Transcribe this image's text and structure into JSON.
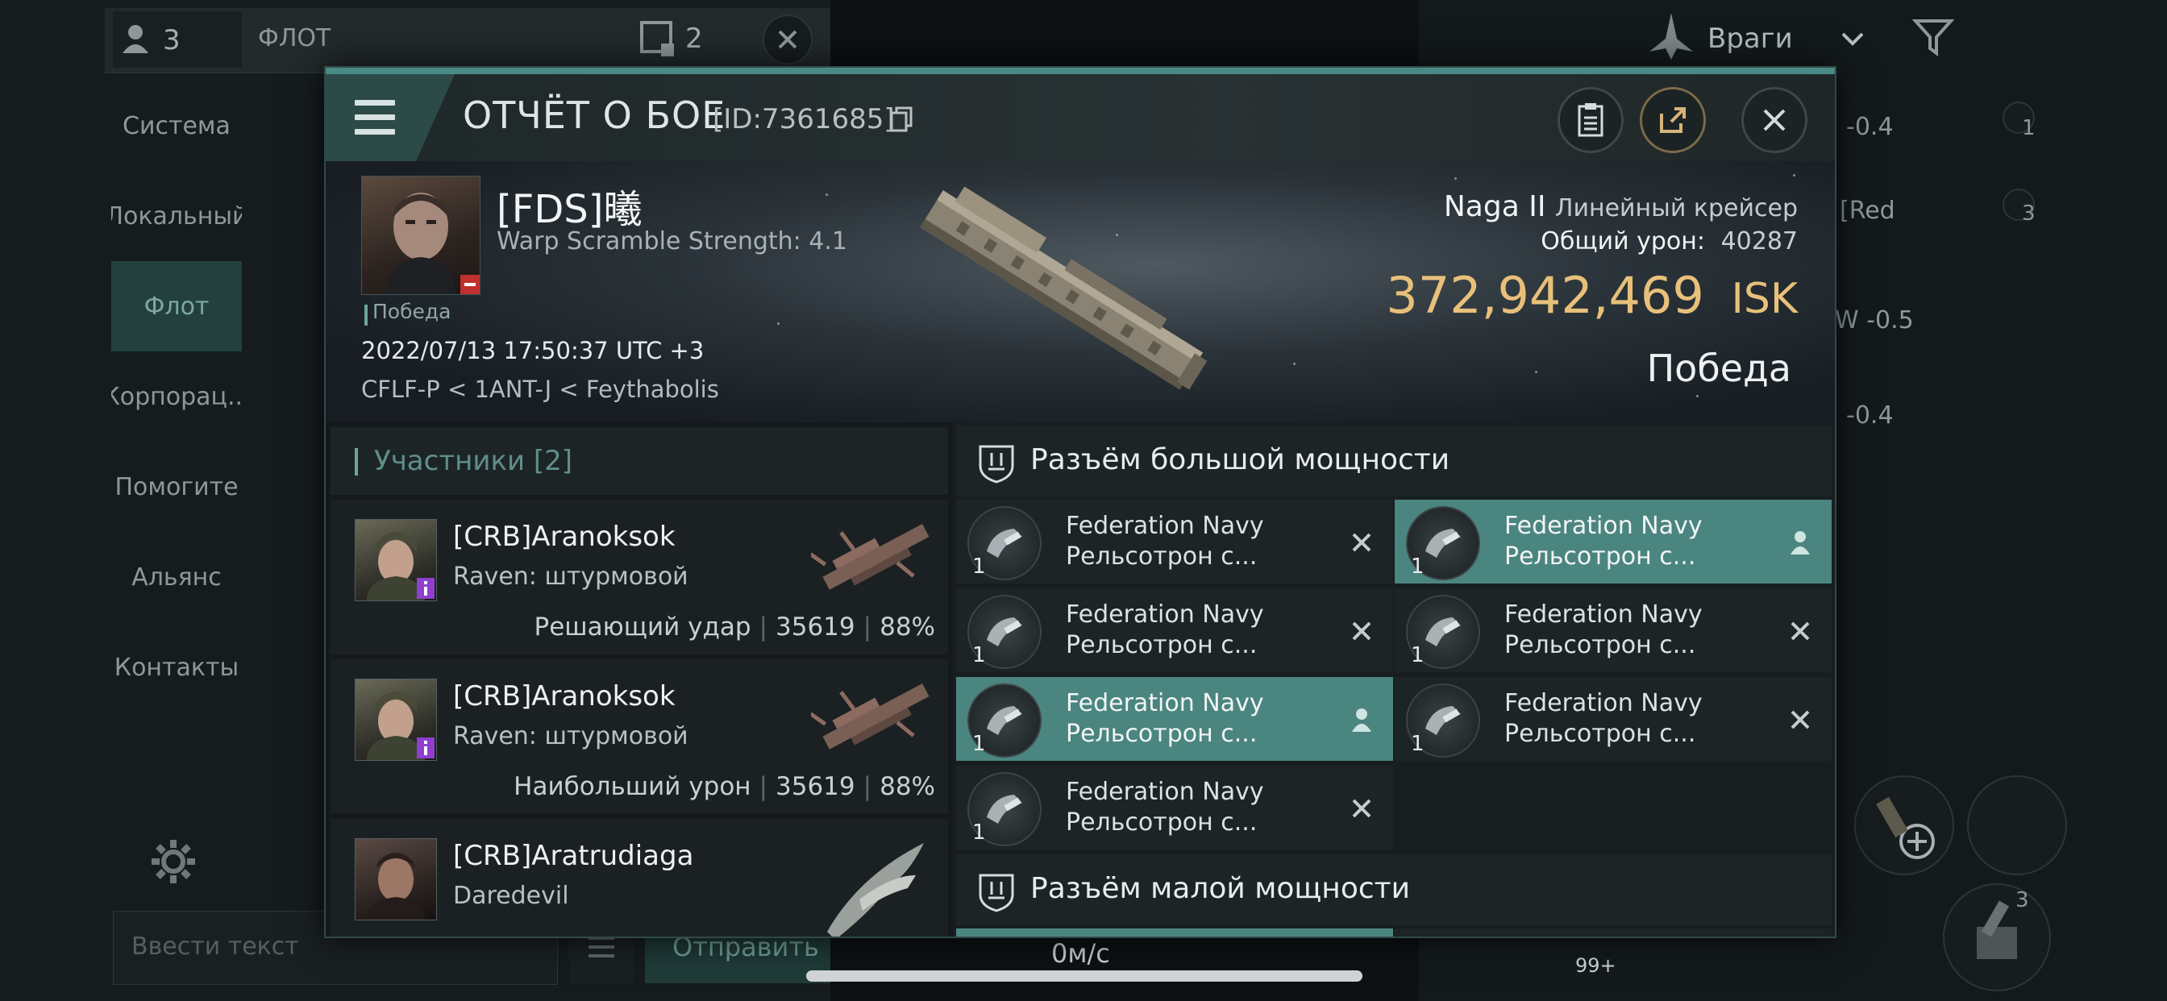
{
  "background": {
    "fleet_count": "3",
    "tab_label": "ФЛОТ",
    "window_count": "2",
    "filter_label": "Враги",
    "channels": [
      "Система",
      "Локальный",
      "Флот",
      "Корпорац...",
      "Помогите",
      "Альянс",
      "Контакты"
    ],
    "active_channel": "Флот",
    "input_placeholder": "Ввести текст",
    "send_label": "Отправить",
    "right_values": [
      "-0.4",
      "[Red",
      "W -0.5",
      "-0.4"
    ],
    "right_counts": [
      "1",
      "3"
    ],
    "speed": "0м/с",
    "module_count": "3",
    "ammo_count": "99+"
  },
  "report": {
    "title": "ОТЧЁТ О БОЕ",
    "id": "[ID:7361685]",
    "victim": {
      "name": "[FDS]曦",
      "sub": "Warp Scramble Strength: 4.1",
      "result": "Победа",
      "date": "2022/07/13 17:50:37 UTC +3",
      "location": "CFLF-P < 1ANT-J < Feythabolis",
      "ship": "Naga II",
      "ship_class": "Линейный крейсер",
      "damage_label": "Общий урон:",
      "damage_value": "40287",
      "isk_value": "372,942,469",
      "isk_unit": "ISK",
      "outcome": "Победа"
    },
    "participants": {
      "title": "Участники [2]",
      "rows": [
        {
          "name": "[CRB]Aranoksok",
          "ship": "Raven: штурмовой",
          "role": "Решающий удар",
          "damage": "35619",
          "percent": "88%"
        },
        {
          "name": "[CRB]Aranoksok",
          "ship": "Raven: штурмовой",
          "role": "Наибольший урон",
          "damage": "35619",
          "percent": "88%"
        },
        {
          "name": "[CRB]Aratrudiaga",
          "ship": "Daredevil",
          "role": "",
          "damage": "",
          "percent": ""
        }
      ]
    },
    "high_slots": {
      "title": "Разъём большой мощности",
      "modules": [
        {
          "line1": "Federation Navy",
          "line2": "Рельсотрон с...",
          "qty": "1",
          "state": "destroyed",
          "action_icon": "x-icon"
        },
        {
          "line1": "Federation Navy",
          "line2": "Рельсотрон с...",
          "qty": "1",
          "state": "dropped",
          "action_icon": "person-icon"
        },
        {
          "line1": "Federation Navy",
          "line2": "Рельсотрон с...",
          "qty": "1",
          "state": "destroyed",
          "action_icon": "x-icon"
        },
        {
          "line1": "Federation Navy",
          "line2": "Рельсотрон с...",
          "qty": "1",
          "state": "destroyed",
          "action_icon": "x-icon"
        },
        {
          "line1": "Federation Navy",
          "line2": "Рельсотрон с...",
          "qty": "1",
          "state": "dropped",
          "action_icon": "person-icon"
        },
        {
          "line1": "Federation Navy",
          "line2": "Рельсотрон с...",
          "qty": "1",
          "state": "destroyed",
          "action_icon": "x-icon"
        },
        {
          "line1": "Federation Navy",
          "line2": "Рельсотрон с...",
          "qty": "1",
          "state": "destroyed",
          "action_icon": "x-icon"
        }
      ]
    },
    "low_slots": {
      "title": "Разъём малой мощности"
    },
    "colors": {
      "accent": "#4b8580",
      "isk": "#e8c07a"
    }
  }
}
